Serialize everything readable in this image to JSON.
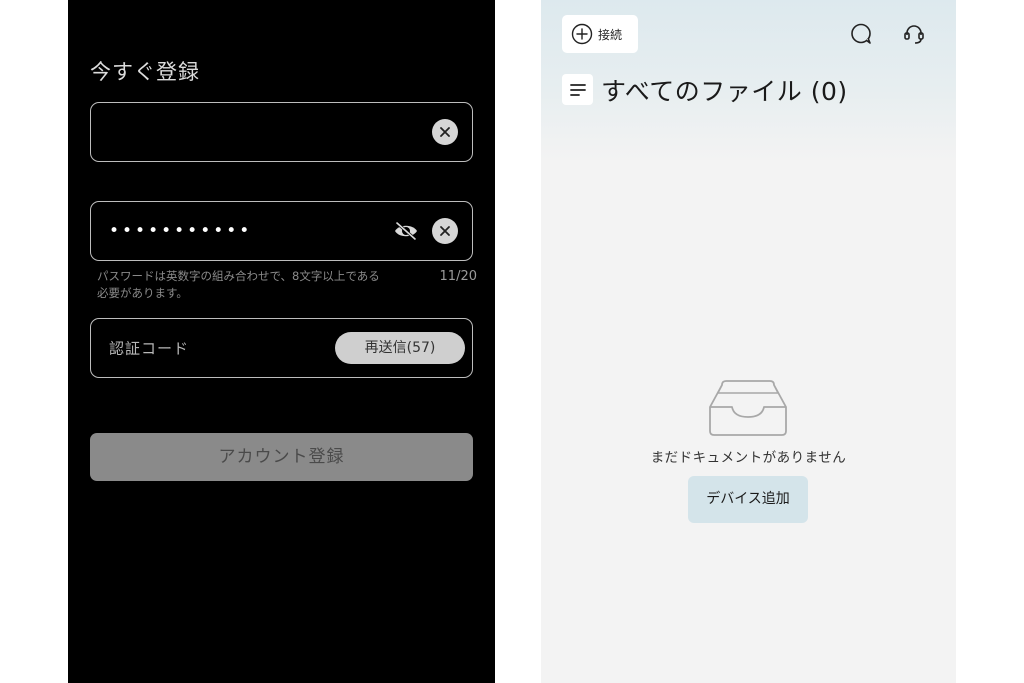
{
  "register": {
    "title": "今すぐ登録",
    "email_value": "",
    "password_value": "•••••••••••",
    "password_hint": "パスワードは英数字の組み合わせで、8文字以上である",
    "password_hint_line2": "必要があります。",
    "password_count": "11/20",
    "code_placeholder": "認証コード",
    "resend_label": "再送信(57)",
    "submit_label": "アカウント登録"
  },
  "files": {
    "connect_label": "接続",
    "title": "すべてのファイル (0)",
    "empty_message": "まだドキュメントがありません",
    "add_device_label": "デバイス追加"
  }
}
